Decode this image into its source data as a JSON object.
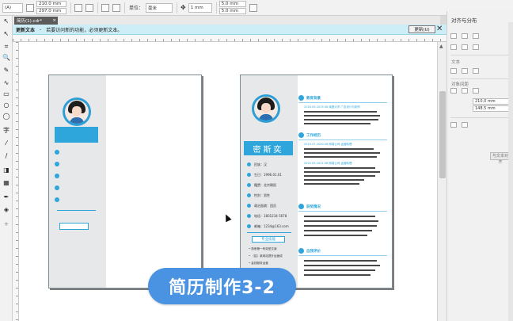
{
  "propbar": {
    "preset": "(A)",
    "width": "210.0 mm",
    "height": "297.0 mm",
    "units_label": "单位：",
    "units_value": "毫米",
    "nudge": "1 mm",
    "dup_x": "5.0 mm",
    "dup_y": "5.0 mm"
  },
  "tab": {
    "label": "简历(1).cdr*",
    "close": "×"
  },
  "hint": {
    "title": "更新文本",
    "dash": "-",
    "message": "若要访问新的功能，必须更新文本。",
    "button": "更新(U)",
    "close": "✕"
  },
  "tools": [
    "↖",
    "↖",
    "⌗",
    "🔍",
    "✎",
    "∿",
    "▭",
    "○",
    "◯",
    "字",
    "⁄",
    "∕",
    "◨",
    "▦",
    "✒",
    "◈",
    "+"
  ],
  "docker": {
    "title": "对齐与分布",
    "label_text": "文本",
    "label_spacing": "对象间距",
    "field_w": "210.0 mm",
    "field_h": "148.5 mm",
    "button": "与文本对齐"
  },
  "left_page": {
    "namebar": ""
  },
  "right_page": {
    "name": "密斯奕",
    "info": [
      "民族：汉",
      "生日：1996.01.01",
      "籍贯：北京朝阳",
      "性别：男性",
      "政治面貌：团员",
      "电话：1801234 5678",
      "邮箱：1234@163.com"
    ],
    "skills_title": "专业技能",
    "skills": [
      "• 熟悉第一有效型文案",
      "• （招）某网站提升运营成",
      "• 金钱服务运营",
      "• 日常团购管理运营"
    ],
    "sections": [
      {
        "title": "教育背景",
        "date": "2016.09-2019.06        南昌大学        广告设计与制作",
        "lines": 5
      },
      {
        "title": "工作经历",
        "date": "2019.07-2020.08        网易公司        运营助理",
        "date2": "2020.09-2021.06        网易公司        运营助理",
        "lines": 8
      },
      {
        "title": "获奖情况",
        "lines": 5
      },
      {
        "title": "自我评价",
        "lines": 4
      }
    ]
  },
  "badge": "简历制作3-2",
  "colors": {
    "accent": "#2fa6db",
    "badge": "#4a92e2",
    "hint_bg": "#cdeef7"
  }
}
